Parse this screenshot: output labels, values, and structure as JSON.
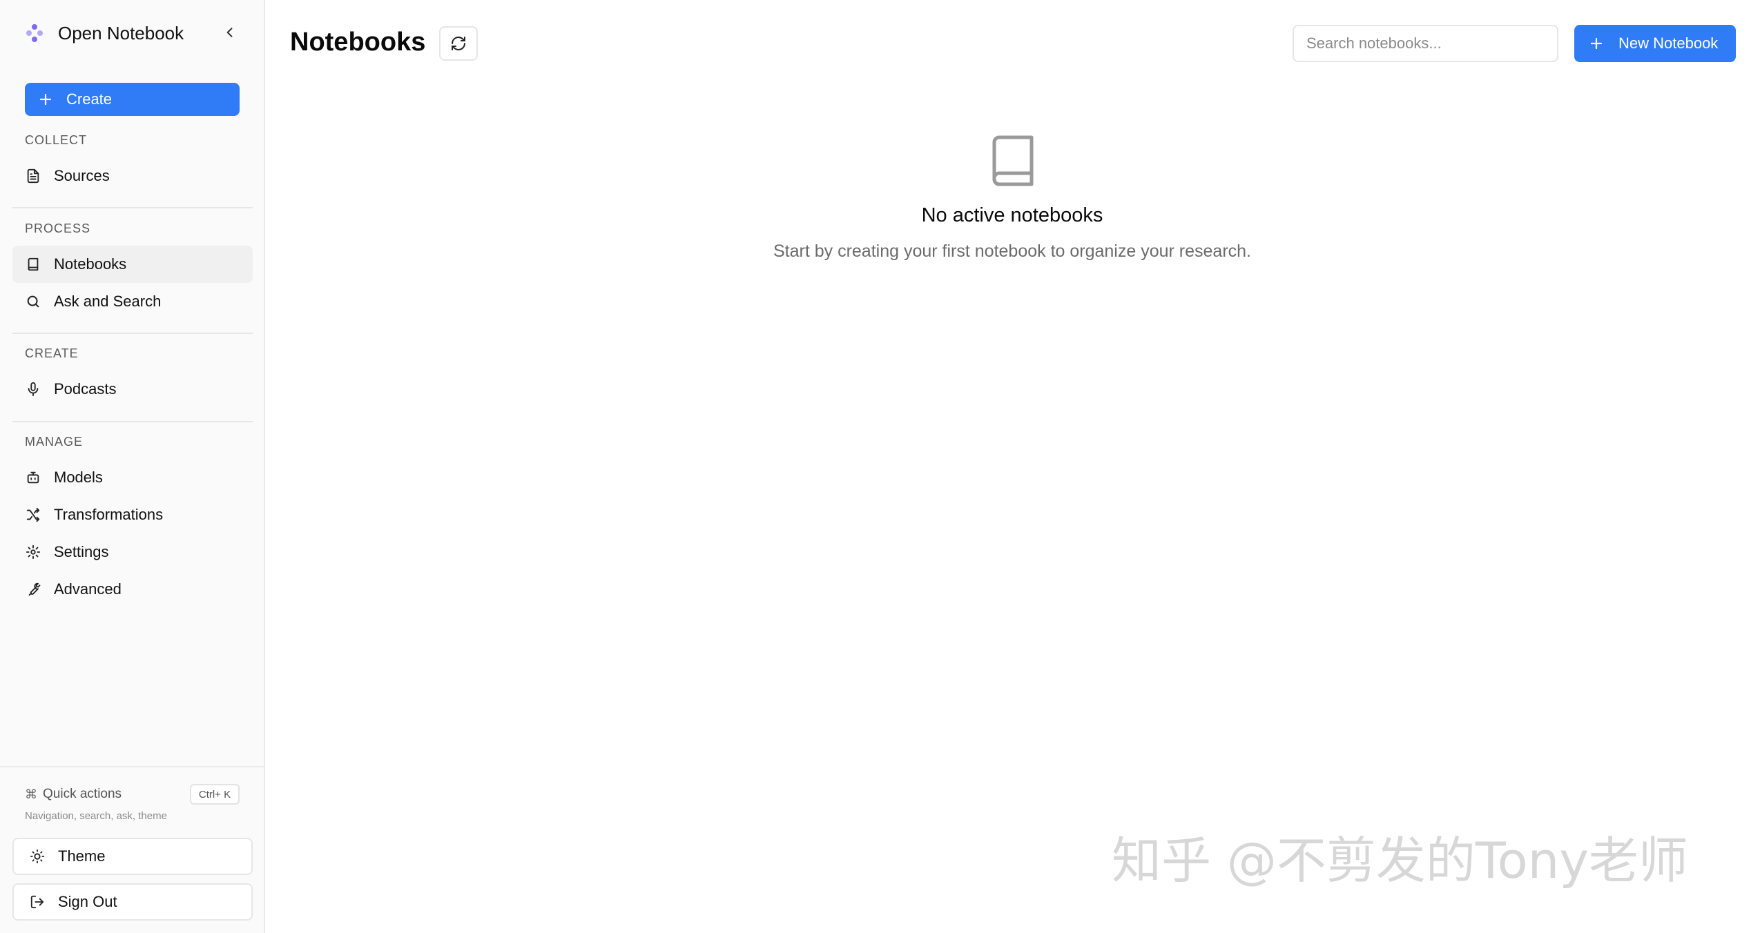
{
  "app": {
    "name": "Open Notebook"
  },
  "colors": {
    "accent": "#2f7cf6",
    "brand_logo": "#7c6cf0"
  },
  "sidebar": {
    "create_label": "Create",
    "sections": [
      {
        "label": "COLLECT",
        "items": [
          {
            "label": "Sources",
            "icon": "file-text-icon"
          }
        ]
      },
      {
        "label": "PROCESS",
        "items": [
          {
            "label": "Notebooks",
            "icon": "book-icon",
            "active": true
          },
          {
            "label": "Ask and Search",
            "icon": "search-icon"
          }
        ]
      },
      {
        "label": "CREATE",
        "items": [
          {
            "label": "Podcasts",
            "icon": "mic-icon"
          }
        ]
      },
      {
        "label": "MANAGE",
        "items": [
          {
            "label": "Models",
            "icon": "bot-icon"
          },
          {
            "label": "Transformations",
            "icon": "shuffle-icon"
          },
          {
            "label": "Settings",
            "icon": "gear-icon"
          },
          {
            "label": "Advanced",
            "icon": "wrench-icon"
          }
        ]
      }
    ],
    "quick_actions": {
      "symbol": "⌘",
      "label": "Quick actions",
      "shortcut": "Ctrl+ K",
      "description": "Navigation, search, ask, theme"
    },
    "theme_label": "Theme",
    "signout_label": "Sign Out"
  },
  "header": {
    "title": "Notebooks",
    "search_placeholder": "Search notebooks...",
    "new_notebook_label": "New Notebook"
  },
  "empty_state": {
    "title": "No active notebooks",
    "subtitle": "Start by creating your first notebook to organize your research."
  },
  "watermark": "知乎 @不剪发的Tony老师"
}
